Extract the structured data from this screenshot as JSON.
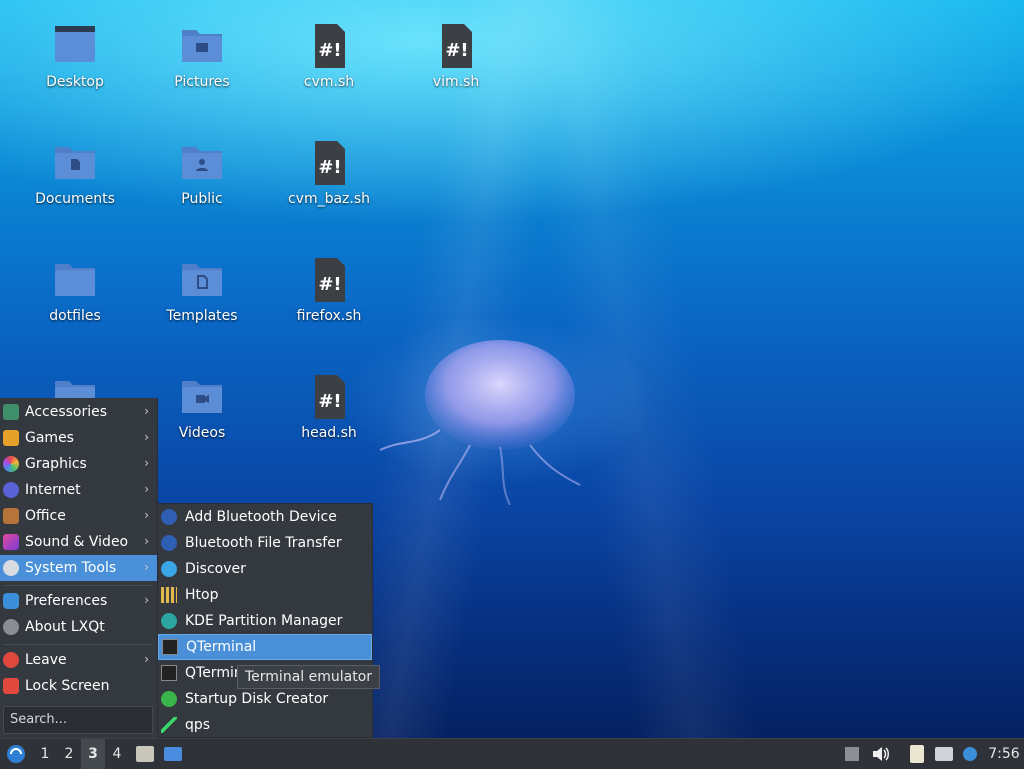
{
  "desktop": {
    "icons": [
      {
        "label": "Desktop"
      },
      {
        "label": "Pictures"
      },
      {
        "label": "cvm.sh"
      },
      {
        "label": "vim.sh"
      },
      {
        "label": "Documents"
      },
      {
        "label": "Public"
      },
      {
        "label": "cvm_baz.sh"
      },
      {
        "label": "dotfiles"
      },
      {
        "label": "Templates"
      },
      {
        "label": "firefox.sh"
      },
      {
        "label": "Videos"
      },
      {
        "label": "head.sh"
      }
    ]
  },
  "menu": {
    "items": [
      {
        "label": "Accessories"
      },
      {
        "label": "Games"
      },
      {
        "label": "Graphics"
      },
      {
        "label": "Internet"
      },
      {
        "label": "Office"
      },
      {
        "label": "Sound & Video"
      },
      {
        "label": "System Tools"
      },
      {
        "label": "Preferences"
      },
      {
        "label": "About LXQt"
      },
      {
        "label": "Leave"
      },
      {
        "label": "Lock Screen"
      }
    ],
    "arrow": "›",
    "search_placeholder": "Search..."
  },
  "submenu": {
    "items": [
      {
        "label": "Add Bluetooth Device"
      },
      {
        "label": "Bluetooth File Transfer"
      },
      {
        "label": "Discover"
      },
      {
        "label": "Htop"
      },
      {
        "label": "KDE Partition Manager"
      },
      {
        "label": "QTerminal"
      },
      {
        "label": "QTerminal"
      },
      {
        "label": "Startup Disk Creator"
      },
      {
        "label": "qps"
      }
    ],
    "tooltip": "Terminal emulator"
  },
  "taskbar": {
    "desktops": [
      "1",
      "2",
      "3",
      "4"
    ],
    "current_desktop": "3",
    "clock": "7:56"
  },
  "colors": {
    "accent": "#4a90d9",
    "panel": "#34383f",
    "folder": "#5b8ed6"
  }
}
